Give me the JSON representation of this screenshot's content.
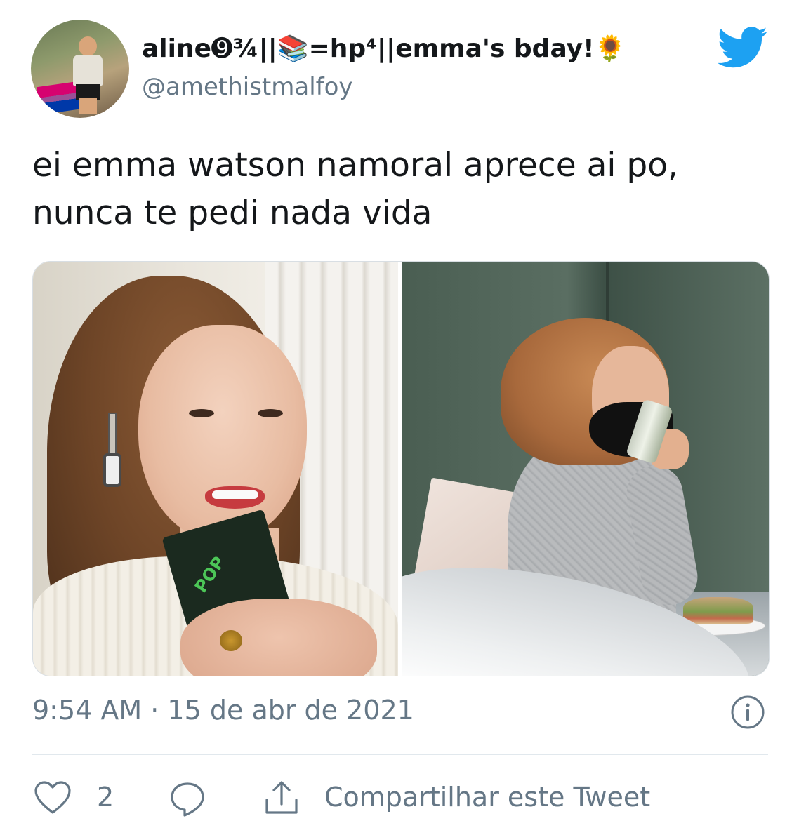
{
  "user": {
    "display_name": "aline➒¾||📚=hp⁴||emma's bday!🌻",
    "handle": "@amethistmalfoy"
  },
  "tweet": {
    "text_lines": [
      "ei emma watson namoral aprece ai po,",
      "nunca te pedi nada vida"
    ],
    "media_count": 2
  },
  "meta": {
    "timestamp": "9:54 AM · 15 de abr de 2021"
  },
  "actions": {
    "like_count": "2",
    "share_label": "Compartilhar este Tweet"
  },
  "icons": {
    "brand": "twitter-bird-icon",
    "info": "info-icon",
    "like": "heart-icon",
    "reply": "reply-icon",
    "share": "share-icon"
  },
  "colors": {
    "twitter_blue": "#1da1f2",
    "text_primary": "#14171a",
    "text_secondary": "#657786",
    "divider": "#e1e8ed"
  }
}
